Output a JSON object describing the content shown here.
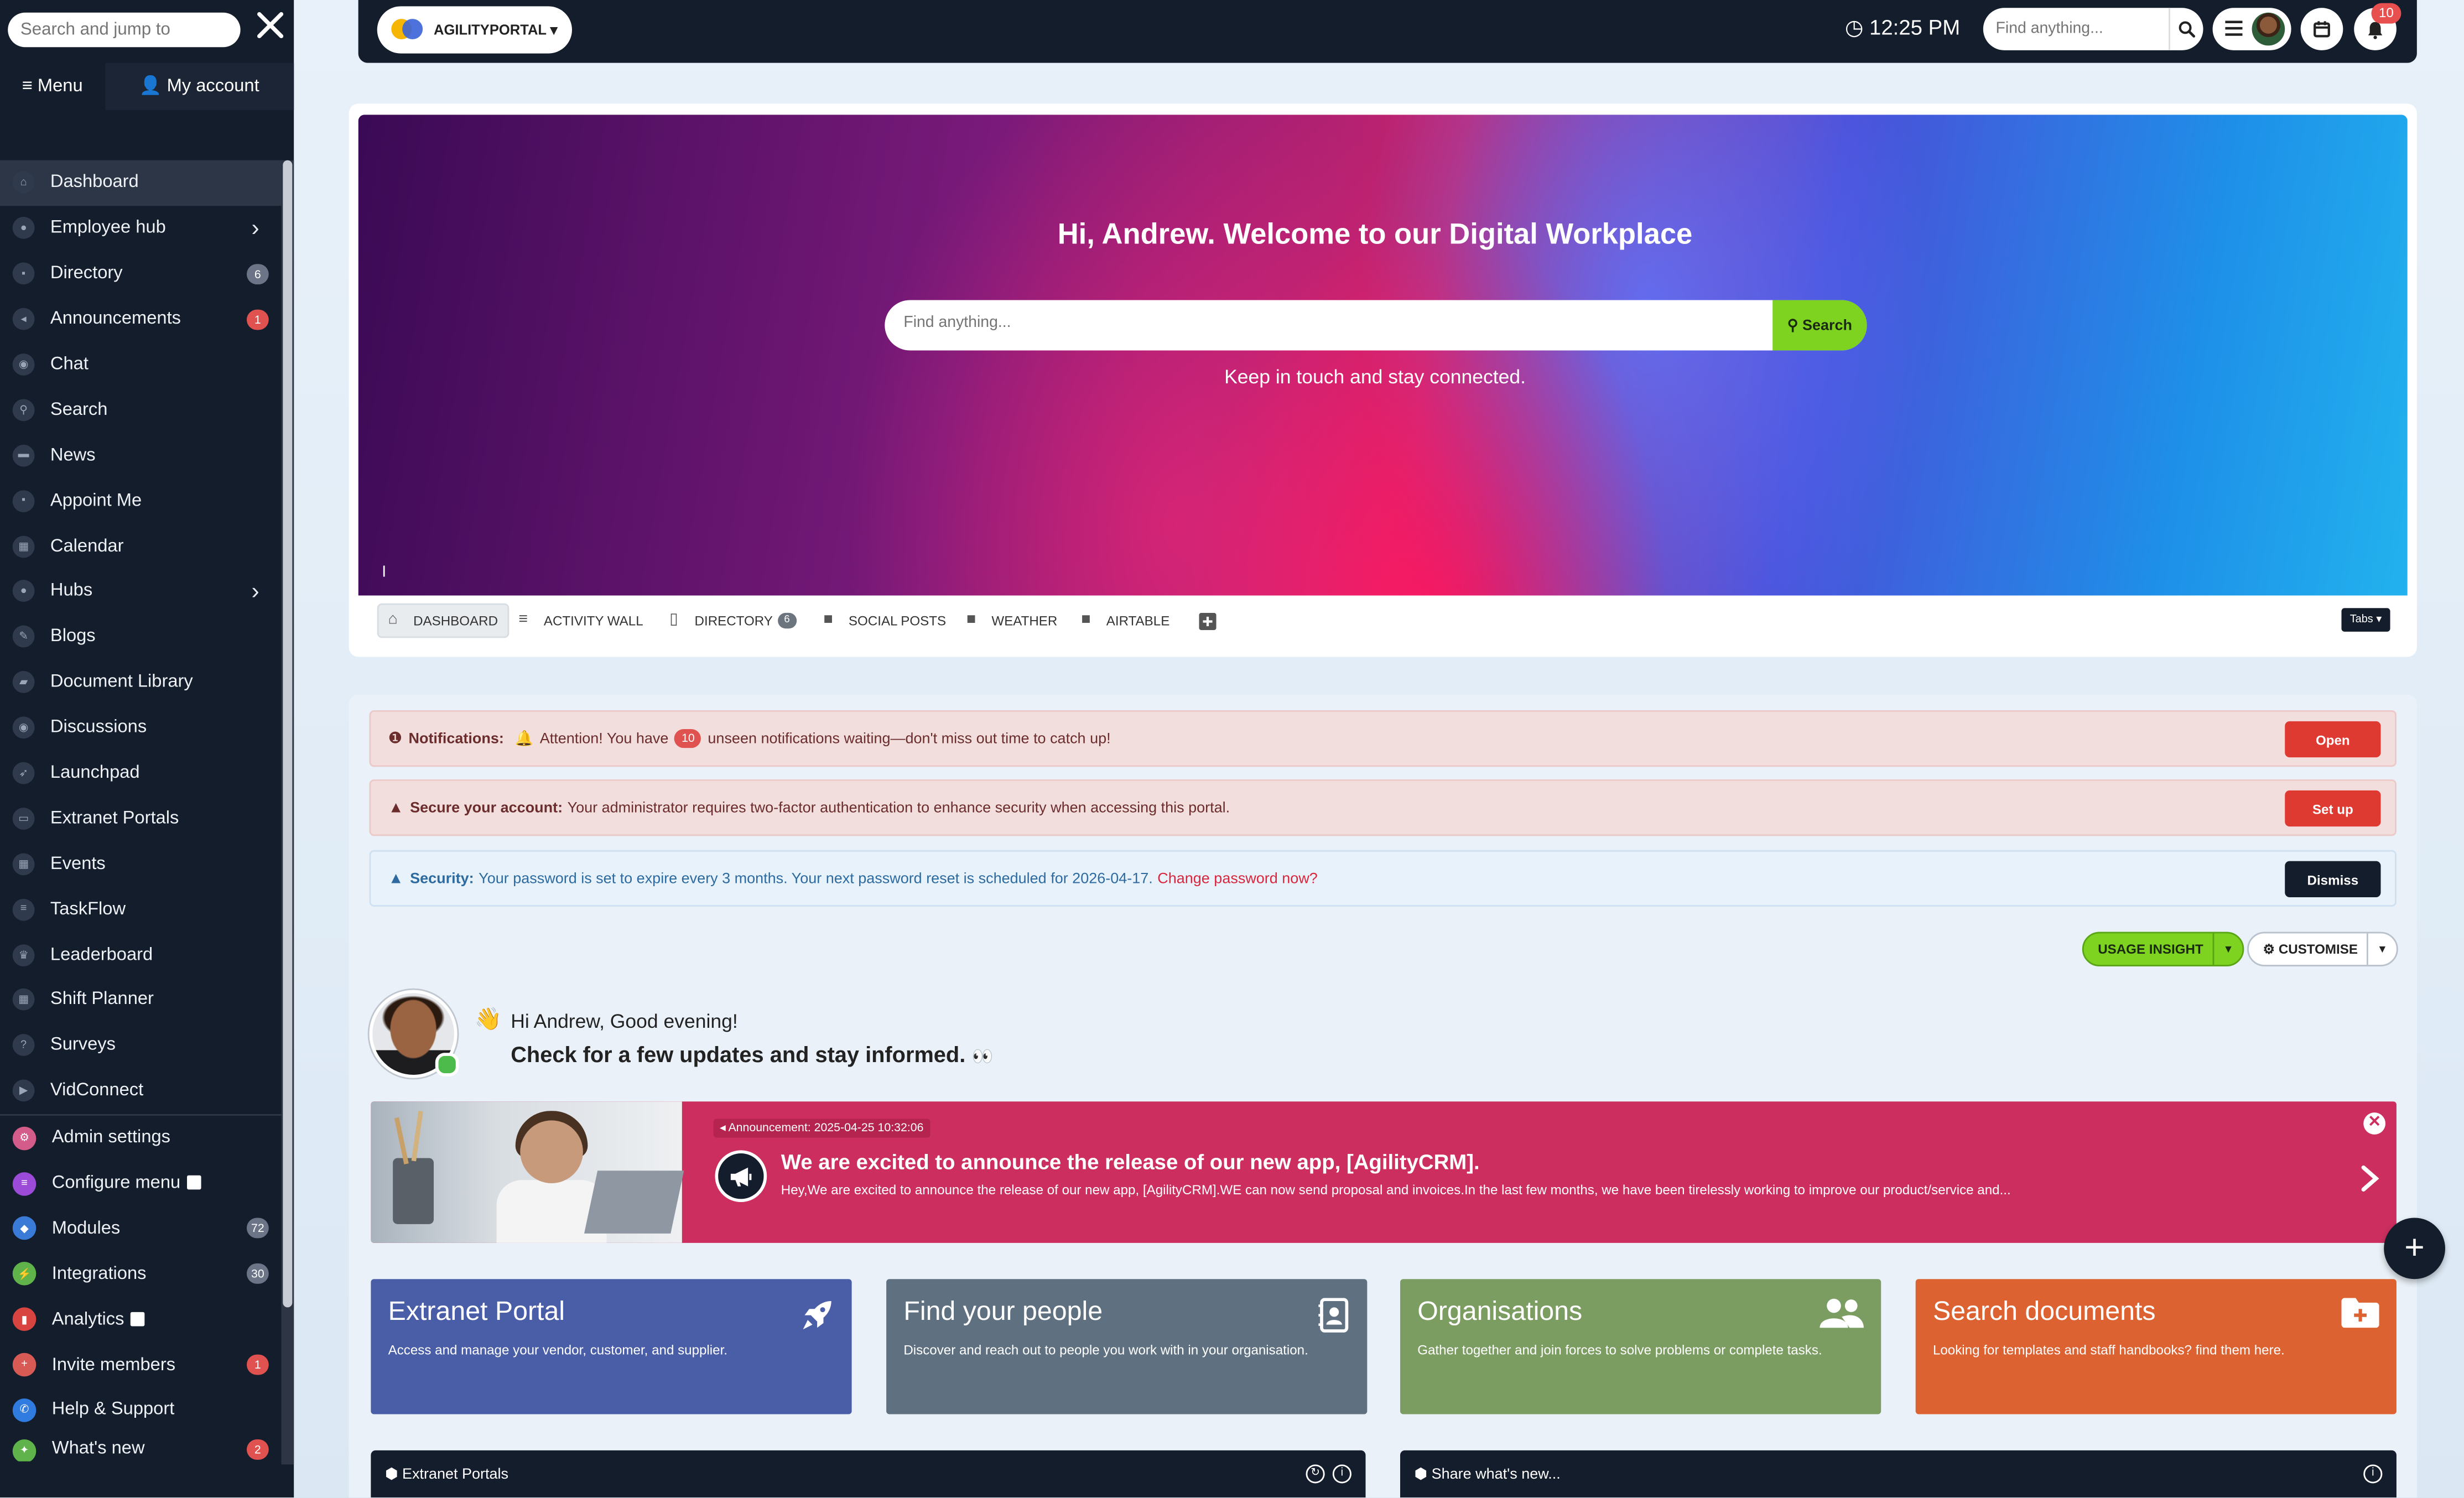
{
  "sidebar": {
    "search_placeholder": "Search and jump to",
    "tabs": {
      "menu": "Menu",
      "account": "My account"
    },
    "items": [
      {
        "label": "Dashboard"
      },
      {
        "label": "Employee hub"
      },
      {
        "label": "Directory",
        "badge": "6"
      },
      {
        "label": "Announcements",
        "badge": "1"
      },
      {
        "label": "Chat"
      },
      {
        "label": "Search"
      },
      {
        "label": "News"
      },
      {
        "label": "Appoint Me"
      },
      {
        "label": "Calendar"
      },
      {
        "label": "Hubs"
      },
      {
        "label": "Blogs"
      },
      {
        "label": "Document Library"
      },
      {
        "label": "Discussions"
      },
      {
        "label": "Launchpad"
      },
      {
        "label": "Extranet Portals"
      },
      {
        "label": "Events"
      },
      {
        "label": "TaskFlow"
      },
      {
        "label": "Leaderboard"
      },
      {
        "label": "Shift Planner"
      },
      {
        "label": "Surveys"
      },
      {
        "label": "VidConnect"
      }
    ],
    "admin_items": [
      {
        "label": "Admin settings",
        "color": "#d45c8a"
      },
      {
        "label": "Configure menu",
        "color": "#9b4bd8"
      },
      {
        "label": "Modules",
        "badge": "72",
        "color": "#3b7bd8"
      },
      {
        "label": "Integrations",
        "badge": "30",
        "color": "#5fb34a"
      },
      {
        "label": "Analytics",
        "color": "#d8443f"
      },
      {
        "label": "Invite members",
        "badge": "1",
        "color": "#d85a55"
      },
      {
        "label": "Help & Support",
        "color": "#2f7be0"
      },
      {
        "label": "What's new",
        "badge": "2",
        "color": "#5fb34a"
      }
    ]
  },
  "topbar": {
    "portal_name": "AGILITYPORTAL",
    "time": "12:25 PM",
    "search_placeholder": "Find anything...",
    "notification_count": "10"
  },
  "hero": {
    "title": "Hi, Andrew. Welcome to our Digital Workplace",
    "search_placeholder": "Find anything...",
    "search_button": "Search",
    "subtitle": "Keep in touch and stay connected.",
    "cursor_mark": "I"
  },
  "tabs": {
    "items": [
      {
        "label": "DASHBOARD"
      },
      {
        "label": "ACTIVITY WALL"
      },
      {
        "label": "DIRECTORY",
        "badge": "6"
      },
      {
        "label": "SOCIAL POSTS"
      },
      {
        "label": "WEATHER"
      },
      {
        "label": "AIRTABLE"
      }
    ],
    "dropdown": "Tabs"
  },
  "alerts": {
    "notifications": {
      "title": "Notifications",
      "text_before": "Attention! You have",
      "count": "10",
      "text_after": "unseen notifications waiting—don't miss out time to catch up!",
      "button": "Open"
    },
    "secure": {
      "title": "Secure your account",
      "text": "Your administrator requires two-factor authentication to enhance security when accessing this portal.",
      "button": "Set up"
    },
    "security": {
      "title": "Security",
      "text": "Your password is set to expire every 3 months. Your next password reset is scheduled for 2026-04-17.",
      "link": "Change password now?",
      "button": "Dismiss"
    }
  },
  "actions": {
    "usage": "USAGE INSIGHT",
    "customise": "CUSTOMISE"
  },
  "greeting": {
    "line1": "Hi Andrew, Good evening!",
    "line2": "Check for a few updates and stay informed."
  },
  "announcement": {
    "tag": "Announcement: 2025-04-25 10:32:06",
    "title": "We are excited to announce the release of our new app, [AgilityCRM].",
    "body": "Hey,We are excited to announce the release of our new app, [AgilityCRM].WE can now send proposal and invoices.In the last few months, we have been tirelessly working to improve our product/service and..."
  },
  "tiles": [
    {
      "title": "Extranet Portal",
      "desc": "Access and manage your vendor, customer, and supplier.",
      "color": "#4a5ea8"
    },
    {
      "title": "Find your people",
      "desc": "Discover and reach out to people you work with in your organisation.",
      "color": "#5f7180"
    },
    {
      "title": "Organisations",
      "desc": "Gather together and join forces to solve problems or complete tasks.",
      "color": "#7c9d62"
    },
    {
      "title": "Search documents",
      "desc": "Looking for templates and staff handbooks? find them here.",
      "color": "#dd6231"
    }
  ],
  "panels": {
    "left": "Extranet Portals",
    "right": "Share what's new..."
  }
}
